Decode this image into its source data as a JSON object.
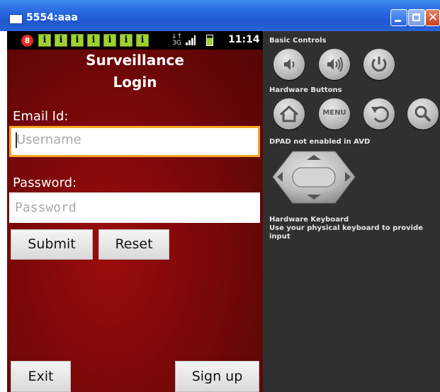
{
  "window": {
    "title": "5554:aaa"
  },
  "status_bar": {
    "notification_count": "8",
    "notification_icons": [
      "i",
      "i",
      "i",
      "i",
      "i",
      "i",
      "i"
    ],
    "network": "3G",
    "time": "11:14"
  },
  "app": {
    "title_line1": "Surveillance",
    "title_line2": "Login"
  },
  "form": {
    "email_label": "Email Id:",
    "email_placeholder": "Username",
    "password_label": "Password:",
    "password_placeholder": "Password",
    "submit_label": "Submit",
    "reset_label": "Reset",
    "exit_label": "Exit",
    "signup_label": "Sign up"
  },
  "controls": {
    "basic_label": "Basic Controls",
    "hardware_label": "Hardware Buttons",
    "menu_label": "MENU",
    "dpad_label": "DPAD not enabled in AVD",
    "keyboard_label": "Hardware Keyboard",
    "keyboard_hint": "Use your physical keyboard to provide input"
  },
  "icons": [
    "window-icon",
    "minimize-icon",
    "maximize-icon",
    "close-icon",
    "signal-icon",
    "battery-icon",
    "volume-down-icon",
    "volume-up-icon",
    "power-icon",
    "home-icon",
    "back-icon",
    "search-icon",
    "dpad-icon"
  ]
}
